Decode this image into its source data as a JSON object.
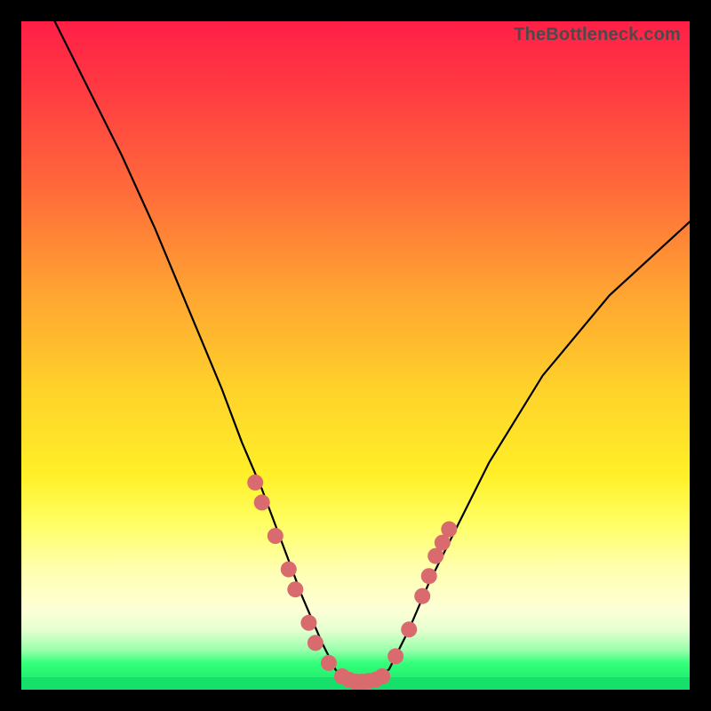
{
  "watermark": "TheBottleneck.com",
  "colors": {
    "background": "#000000",
    "marker": "#d96b6f",
    "curve": "#000000",
    "gradient_top": "#ff1f47",
    "gradient_bottom": "#17e56a"
  },
  "chart_data": {
    "type": "line",
    "title": "",
    "xlabel": "",
    "ylabel": "",
    "xlim": [
      0,
      100
    ],
    "ylim": [
      0,
      100
    ],
    "grid": false,
    "note": "V-shaped bottleneck curve; y≈0 at the valley is optimal (green), high y is worst (red). x is an unlabeled configuration axis. Values estimated from pixel positions.",
    "series": [
      {
        "name": "bottleneck-curve",
        "x": [
          5,
          10,
          15,
          20,
          25,
          30,
          33,
          36,
          39,
          42,
          45,
          47,
          49,
          51,
          55,
          58,
          61,
          65,
          70,
          78,
          88,
          100
        ],
        "y": [
          100,
          90,
          80,
          69,
          57,
          45,
          37,
          30,
          22,
          14,
          7,
          3,
          1,
          1,
          3,
          9,
          16,
          24,
          34,
          47,
          59,
          70
        ]
      }
    ],
    "markers": {
      "name": "highlighted-points",
      "note": "salmon dots clustered along the lower flanks and flat valley",
      "points": [
        {
          "x": 35,
          "y": 31
        },
        {
          "x": 36,
          "y": 28
        },
        {
          "x": 38,
          "y": 23
        },
        {
          "x": 40,
          "y": 18
        },
        {
          "x": 41,
          "y": 15
        },
        {
          "x": 43,
          "y": 10
        },
        {
          "x": 44,
          "y": 7
        },
        {
          "x": 46,
          "y": 4
        },
        {
          "x": 48,
          "y": 2
        },
        {
          "x": 49,
          "y": 1.5
        },
        {
          "x": 50,
          "y": 1.2
        },
        {
          "x": 51,
          "y": 1.2
        },
        {
          "x": 52,
          "y": 1.3
        },
        {
          "x": 53,
          "y": 1.5
        },
        {
          "x": 54,
          "y": 2
        },
        {
          "x": 56,
          "y": 5
        },
        {
          "x": 58,
          "y": 9
        },
        {
          "x": 60,
          "y": 14
        },
        {
          "x": 61,
          "y": 17
        },
        {
          "x": 62,
          "y": 20
        },
        {
          "x": 63,
          "y": 22
        },
        {
          "x": 64,
          "y": 24
        }
      ]
    }
  }
}
